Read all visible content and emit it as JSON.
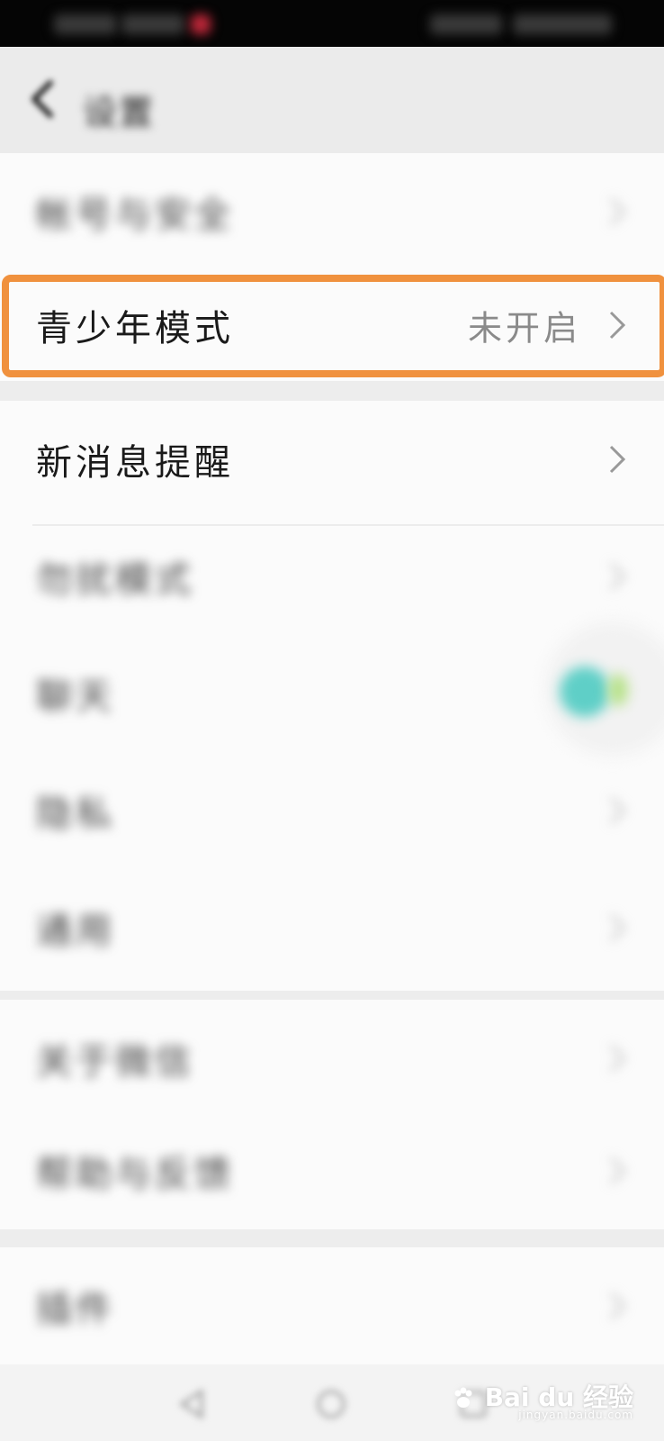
{
  "status_bar": {},
  "header": {
    "title": "设置",
    "back_icon": "chevron-left-icon"
  },
  "settings": {
    "group1": [
      {
        "label": "帐号与安全",
        "blurred": true
      },
      {
        "label": "青少年模式",
        "value": "未开启",
        "highlighted": true
      }
    ],
    "group2": [
      {
        "label": "新消息提醒"
      },
      {
        "label": "勿扰模式",
        "blurred": true
      },
      {
        "label": "聊天",
        "blurred": true
      },
      {
        "label": "隐私",
        "blurred": true
      },
      {
        "label": "通用",
        "blurred": true
      }
    ],
    "group3": [
      {
        "label": "关于微信",
        "blurred": true
      },
      {
        "label": "帮助与反馈",
        "blurred": true
      }
    ],
    "group4": [
      {
        "label": "插件",
        "blurred": true
      }
    ]
  },
  "highlight_color": "#f0913e",
  "watermark": {
    "brand": "Bai du 经验",
    "url": "jingyan.baidu.com"
  },
  "nav_bar": {
    "buttons": [
      "back-icon",
      "home-icon",
      "recents-icon"
    ]
  }
}
